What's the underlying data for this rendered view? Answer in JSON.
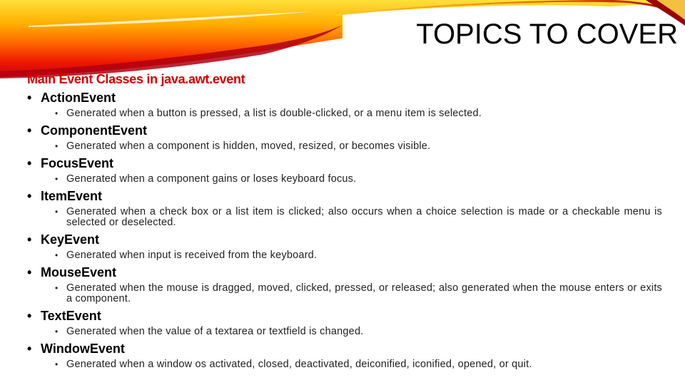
{
  "slide": {
    "title": "TOPICS TO COVER",
    "heading": "Main Event Classes in java.awt.event",
    "bullet_glyph": "•",
    "colors": {
      "heading": "#d40000",
      "swoosh_yellow": "#ffd21a",
      "swoosh_orange": "#ff7a00",
      "swoosh_red": "#e10000",
      "swoosh_dark_red": "#9a0000"
    },
    "items": [
      {
        "name": "ActionEvent",
        "desc": "Generated when a button is pressed, a list is double-clicked, or a menu item is selected."
      },
      {
        "name": "ComponentEvent",
        "desc": "Generated when a component is hidden, moved, resized, or becomes visible."
      },
      {
        "name": "FocusEvent",
        "desc": "Generated when a component gains or loses keyboard focus."
      },
      {
        "name": "ItemEvent",
        "desc": "Generated when a check box or a list item is clicked; also occurs when a choice selection is made or a checkable menu is selected or deselected."
      },
      {
        "name": "KeyEvent",
        "desc": "Generated when input is received from the keyboard."
      },
      {
        "name": "MouseEvent",
        "desc": "Generated when the mouse is dragged, moved, clicked, pressed, or released; also generated when the mouse enters or exits a component."
      },
      {
        "name": "TextEvent",
        "desc": "Generated when the value of a textarea or textfield is changed."
      },
      {
        "name": "WindowEvent",
        "desc": "Generated when a window os activated, closed, deactivated, deiconified, iconified, opened, or quit."
      }
    ]
  }
}
